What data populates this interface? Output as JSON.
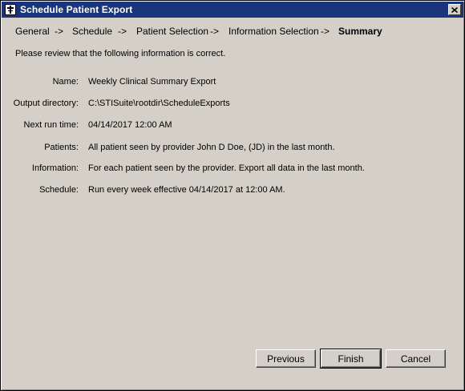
{
  "window": {
    "title": "Schedule Patient Export",
    "app_icon": "app-icon",
    "close_icon": "close-icon"
  },
  "breadcrumb": {
    "steps": [
      "General",
      "Schedule",
      "Patient Selection",
      "Information Selection",
      "Summary"
    ],
    "separator": "->",
    "current": "Summary"
  },
  "intro": "Please review that the following information is correct.",
  "summary": {
    "name_label": "Name:",
    "name_value": "Weekly Clinical Summary Export",
    "output_label": "Output directory:",
    "output_value": "C:\\STISuite\\rootdir\\ScheduleExports",
    "next_run_label": "Next run time:",
    "next_run_value": "04/14/2017 12:00 AM",
    "patients_label": "Patients:",
    "patients_value": "All patient seen by provider John D Doe,  (JD) in the last month.",
    "information_label": "Information:",
    "information_value": "For each patient seen by the provider. Export all data in the last month.",
    "schedule_label": "Schedule:",
    "schedule_value": "Run every week effective 04/14/2017 at 12:00 AM."
  },
  "buttons": {
    "previous": "Previous",
    "finish": "Finish",
    "cancel": "Cancel"
  },
  "colors": {
    "titlebar": "#1a3579",
    "face": "#d4d0c8"
  }
}
